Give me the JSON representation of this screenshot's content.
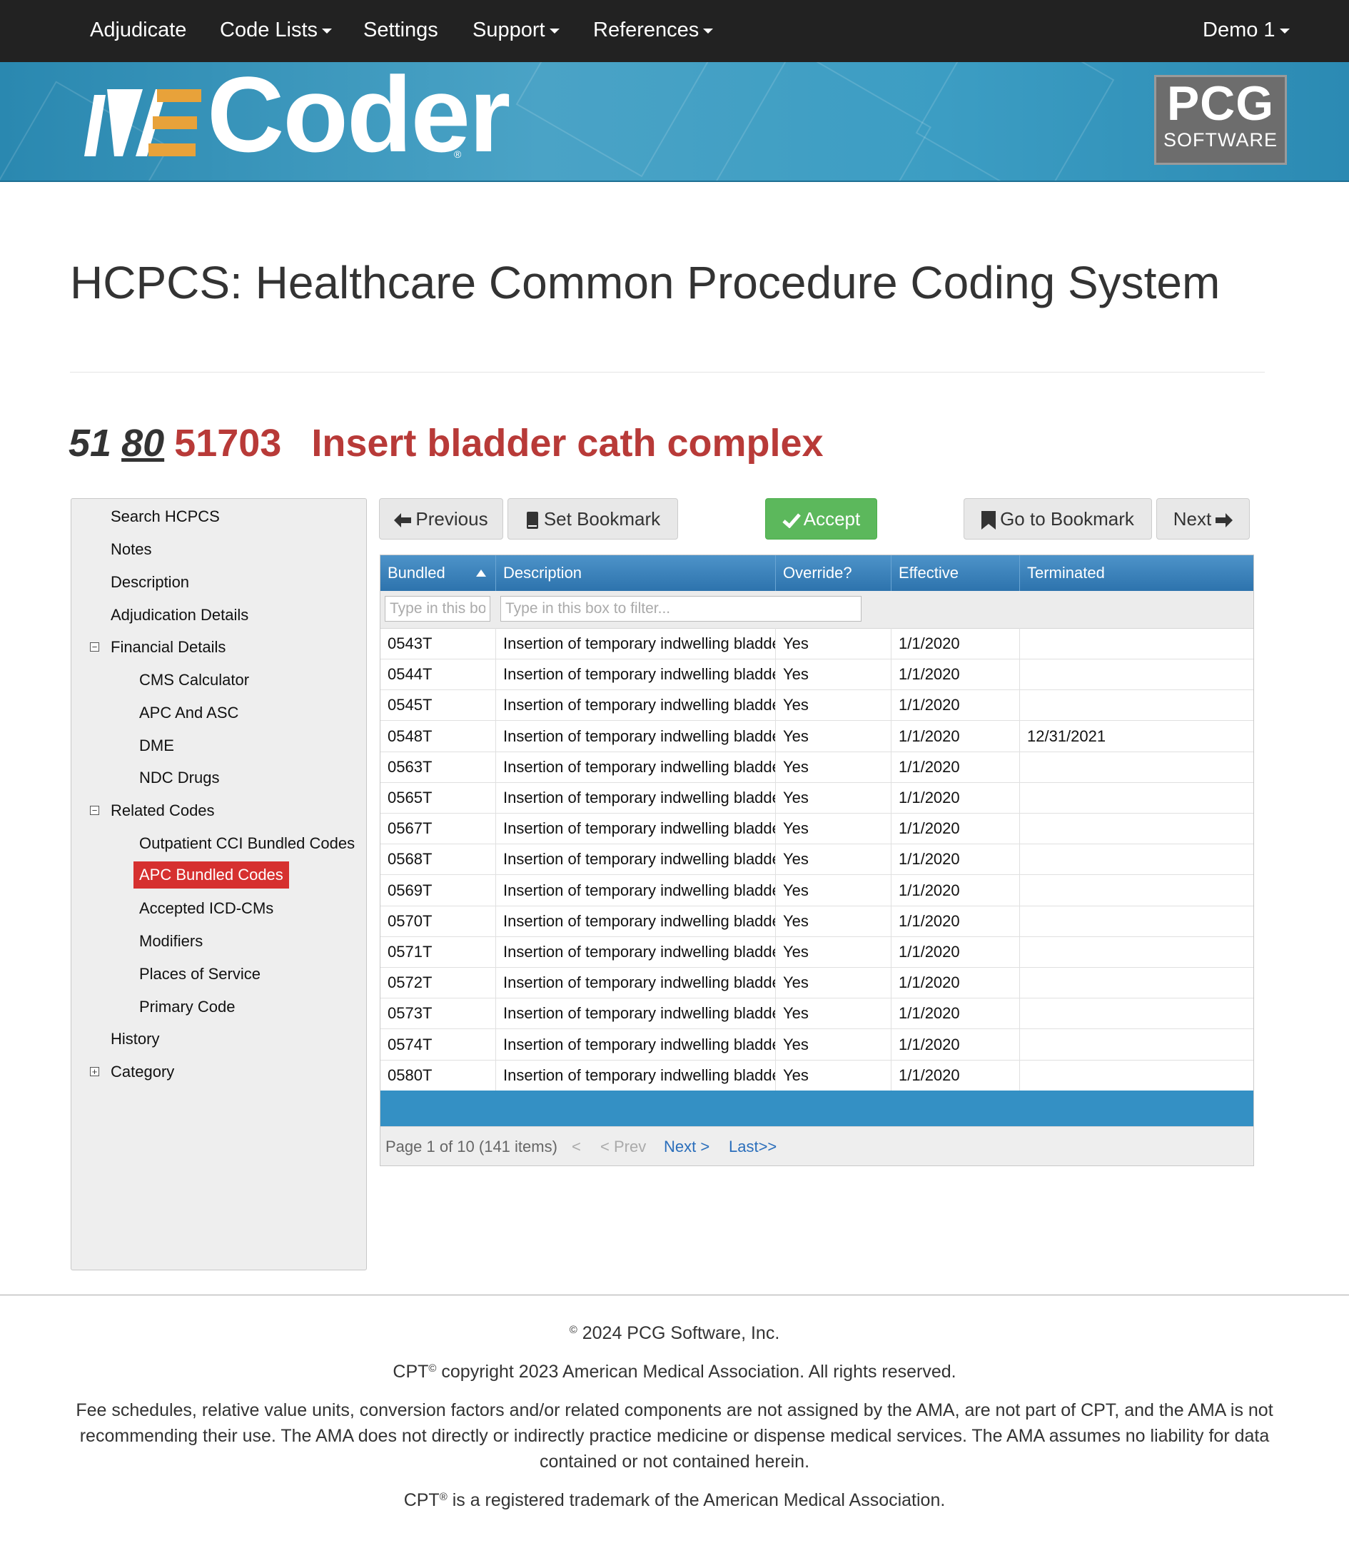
{
  "nav": {
    "items": [
      {
        "label": "Adjudicate",
        "caret": false
      },
      {
        "label": "Code Lists",
        "caret": true
      },
      {
        "label": "Settings",
        "caret": false
      },
      {
        "label": "Support",
        "caret": true
      },
      {
        "label": "References",
        "caret": true
      }
    ],
    "user": "Demo 1"
  },
  "banner": {
    "logo_text": "Coder",
    "logo_mark": "iVE",
    "brand_big": "PCG",
    "brand_small": "SOFTWARE",
    "accent_color": "#e8a23a"
  },
  "page": {
    "title": "HCPCS: Healthcare Common Procedure Coding System",
    "code_prefix": "51",
    "code_link": "80",
    "code": "51703",
    "code_description": "Insert bladder cath complex"
  },
  "sidebar": {
    "items": [
      {
        "label": "Search HCPCS",
        "level": 0
      },
      {
        "label": "Notes",
        "level": 0
      },
      {
        "label": "Description",
        "level": 0
      },
      {
        "label": "Adjudication Details",
        "level": 0
      },
      {
        "label": "Financial Details",
        "level": 0,
        "toggle": "−"
      },
      {
        "label": "CMS Calculator",
        "level": 1
      },
      {
        "label": "APC And ASC",
        "level": 1
      },
      {
        "label": "DME",
        "level": 1
      },
      {
        "label": "NDC Drugs",
        "level": 1
      },
      {
        "label": "Related Codes",
        "level": 0,
        "toggle": "−"
      },
      {
        "label": "Outpatient CCI Bundled Codes",
        "level": 1
      },
      {
        "label": "APC Bundled Codes",
        "level": 1,
        "active": true
      },
      {
        "label": "Accepted ICD-CMs",
        "level": 1
      },
      {
        "label": "Modifiers",
        "level": 1
      },
      {
        "label": "Places of Service",
        "level": 1
      },
      {
        "label": "Primary Code",
        "level": 1
      },
      {
        "label": "History",
        "level": 0
      },
      {
        "label": "Category",
        "level": 0,
        "toggle": "+"
      }
    ]
  },
  "toolbar": {
    "previous": "Previous",
    "set_bookmark": "Set Bookmark",
    "accept": "Accept",
    "go_to_bookmark": "Go to Bookmark",
    "next": "Next"
  },
  "grid": {
    "columns": [
      "Bundled",
      "Description",
      "Override?",
      "Effective",
      "Terminated"
    ],
    "filter_placeholder_short": "Type in this box to filter...",
    "filter_placeholder": "Type in this box to filter...",
    "rows": [
      [
        "0543T",
        "Insertion of temporary indwelling bladder catheter; complex",
        "Yes",
        "1/1/2020",
        ""
      ],
      [
        "0544T",
        "Insertion of temporary indwelling bladder catheter; complex",
        "Yes",
        "1/1/2020",
        ""
      ],
      [
        "0545T",
        "Insertion of temporary indwelling bladder catheter; complex",
        "Yes",
        "1/1/2020",
        ""
      ],
      [
        "0548T",
        "Insertion of temporary indwelling bladder catheter; complex",
        "Yes",
        "1/1/2020",
        "12/31/2021"
      ],
      [
        "0563T",
        "Insertion of temporary indwelling bladder catheter; complex",
        "Yes",
        "1/1/2020",
        ""
      ],
      [
        "0565T",
        "Insertion of temporary indwelling bladder catheter; complex",
        "Yes",
        "1/1/2020",
        ""
      ],
      [
        "0567T",
        "Insertion of temporary indwelling bladder catheter; complex",
        "Yes",
        "1/1/2020",
        ""
      ],
      [
        "0568T",
        "Insertion of temporary indwelling bladder catheter; complex",
        "Yes",
        "1/1/2020",
        ""
      ],
      [
        "0569T",
        "Insertion of temporary indwelling bladder catheter; complex",
        "Yes",
        "1/1/2020",
        ""
      ],
      [
        "0570T",
        "Insertion of temporary indwelling bladder catheter; complex",
        "Yes",
        "1/1/2020",
        ""
      ],
      [
        "0571T",
        "Insertion of temporary indwelling bladder catheter; complex",
        "Yes",
        "1/1/2020",
        ""
      ],
      [
        "0572T",
        "Insertion of temporary indwelling bladder catheter; complex",
        "Yes",
        "1/1/2020",
        ""
      ],
      [
        "0573T",
        "Insertion of temporary indwelling bladder catheter; complex",
        "Yes",
        "1/1/2020",
        ""
      ],
      [
        "0574T",
        "Insertion of temporary indwelling bladder catheter; complex",
        "Yes",
        "1/1/2020",
        ""
      ],
      [
        "0580T",
        "Insertion of temporary indwelling bladder catheter; complex",
        "Yes",
        "1/1/2020",
        ""
      ]
    ],
    "pager": {
      "summary": "Page 1 of 10 (141 items)",
      "first": "<",
      "prev": "< Prev",
      "next": "Next >",
      "last": "Last>>"
    }
  },
  "footer": {
    "copyright": "2024 PCG Software, Inc.",
    "cpt_copyright": "copyright 2023 American Medical Association. All rights reserved.",
    "disclaimer": "Fee schedules, relative value units, conversion factors and/or related components are not assigned by the AMA, are not part of CPT, and the AMA is not recommending their use. The AMA does not directly or indirectly practice medicine or dispense medical services. The AMA assumes no liability for data contained or not contained herein.",
    "trademark": "is a registered trademark of the American Medical Association.",
    "cpt_label": "CPT",
    "copy_symbol": "©",
    "reg_symbol": "®"
  }
}
